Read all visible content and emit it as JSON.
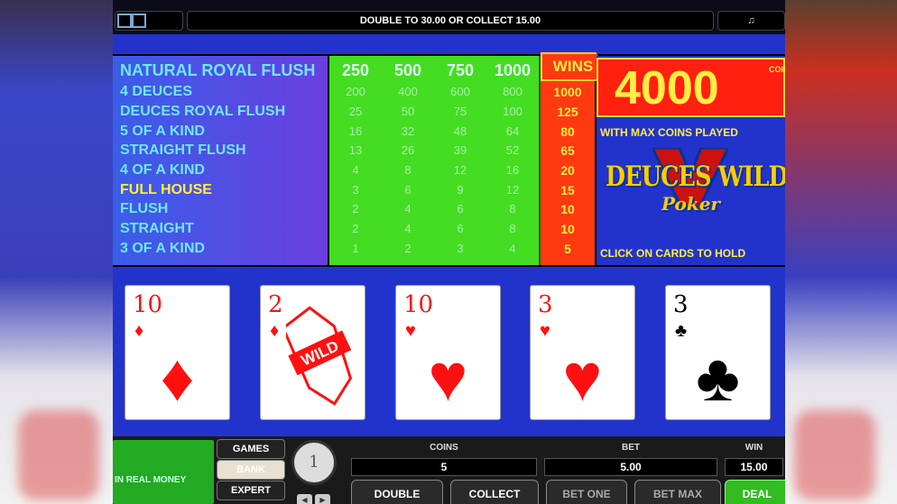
{
  "topbar": {
    "left_icon": "menu-icon",
    "message": "DOUBLE TO 30.00 OR COLLECT 15.00",
    "right_icon": "sound-icon"
  },
  "paytable": {
    "hands": [
      "NATURAL ROYAL FLUSH",
      "4 DEUCES",
      "DEUCES ROYAL FLUSH",
      "5 OF A KIND",
      "STRAIGHT FLUSH",
      "4 OF A KIND",
      "FULL HOUSE",
      "FLUSH",
      "STRAIGHT",
      "3 OF A KIND"
    ],
    "columns": [
      [
        "250",
        "200",
        "25",
        "16",
        "13",
        "4",
        "3",
        "2",
        "2",
        "1"
      ],
      [
        "500",
        "400",
        "50",
        "32",
        "26",
        "8",
        "6",
        "4",
        "4",
        "2"
      ],
      [
        "750",
        "600",
        "75",
        "48",
        "39",
        "12",
        "9",
        "6",
        "6",
        "3"
      ],
      [
        "1000",
        "800",
        "100",
        "64",
        "52",
        "16",
        "12",
        "8",
        "8",
        "4"
      ]
    ],
    "wins_label": "WINS",
    "wins": [
      "",
      "1000",
      "125",
      "80",
      "65",
      "20",
      "15",
      "10",
      "10",
      "5"
    ]
  },
  "info": {
    "jackpot": "4000",
    "coins_label": "COINS",
    "max_coins_text": "WITH MAX COINS PLAYED",
    "logo_line1": "DEUCES WILD",
    "logo_line2": "Poker",
    "hold_text": "CLICK ON CARDS TO HOLD"
  },
  "cards": [
    {
      "rank": "10",
      "suit": "♦",
      "color": "red"
    },
    {
      "rank": "2",
      "suit": "♦",
      "color": "red",
      "wild_text": "WILD"
    },
    {
      "rank": "10",
      "suit": "♥",
      "color": "red"
    },
    {
      "rank": "3",
      "suit": "♥",
      "color": "red"
    },
    {
      "rank": "3",
      "suit": "♣",
      "color": "black"
    }
  ],
  "bottom": {
    "real_money": "IN REAL MONEY",
    "side_buttons": [
      "GAMES",
      "BANK",
      "EXPERT"
    ],
    "dial_value": "1",
    "coins_label": "COINS",
    "coins_value": "5",
    "bet_label": "BET",
    "bet_value": "5.00",
    "win_label": "WIN",
    "win_value": "15.00",
    "buttons": [
      "DOUBLE",
      "COLLECT",
      "BET ONE",
      "BET MAX",
      "DEAL"
    ]
  }
}
